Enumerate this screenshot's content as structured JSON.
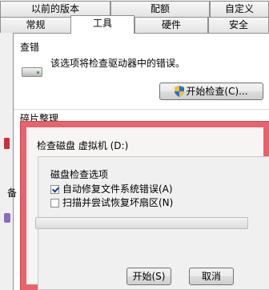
{
  "properties": {
    "tabs_row1": [
      "以前的版本",
      "配额",
      "自定义"
    ],
    "tabs_row2": [
      "常规",
      "工具",
      "硬件",
      "安全"
    ],
    "active_tab": "工具",
    "error_check": {
      "group_title": "查错",
      "description": "该选项将检查驱动器中的错误。",
      "button_label": "开始检查(C)..."
    },
    "defrag": {
      "group_title": "碎片整理"
    },
    "backup": {
      "group_title_partial": "备"
    }
  },
  "check_disk": {
    "title": "检查磁盘 虚拟机 (D:)",
    "options_title": "磁盘检查选项",
    "options": [
      {
        "label": "自动修复文件系统错误(A)",
        "checked": true
      },
      {
        "label": "扫描并尝试恢复坏扇区(N)",
        "checked": false
      }
    ],
    "progress": 0,
    "start_label": "开始(S)",
    "cancel_label": "取消"
  },
  "colors": {
    "highlight_border": "#e8636d",
    "shield_blue": "#2a6fd0",
    "shield_yellow": "#f0c030"
  }
}
